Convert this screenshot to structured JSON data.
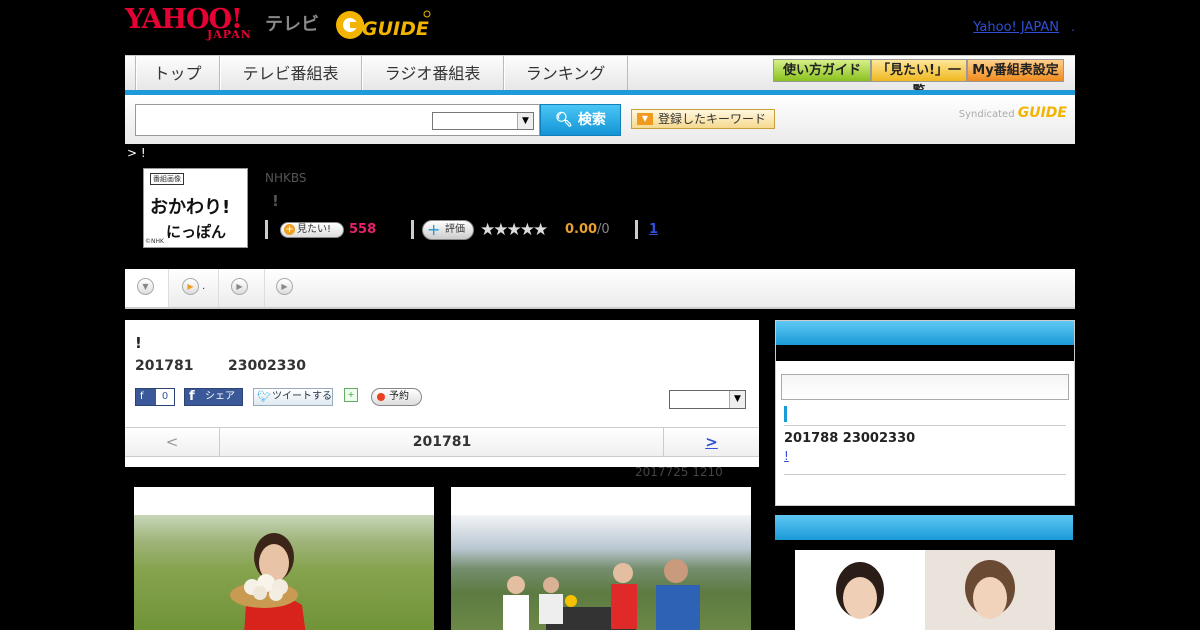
{
  "header": {
    "yahoo_logo": "YAHOO!",
    "yahoo_sub": "JAPAN",
    "tv_label": "テレビ",
    "gguide_logo": "GUIDE",
    "top_link": "Yahoo! JAPAN",
    "top_link_suffix": "."
  },
  "nav": {
    "tabs": [
      "トップ",
      "テレビ番組表",
      "ラジオ番組表",
      "ランキング"
    ],
    "buttons": [
      "使い方ガイド",
      "「見たい!」一覧",
      "My番組表設定"
    ]
  },
  "search": {
    "value": "",
    "select_value": "",
    "button_label": "検索",
    "keyword_button": "登録したキーワード",
    "syndicated": "Syndicated",
    "syndicated_logo": "GUIDE"
  },
  "breadcrumb": ">  !",
  "program": {
    "thumb_badge": "番組画像",
    "thumb_title": "おかわり!",
    "thumb_title2": "にっぽん",
    "thumb_credit": "©NHK",
    "channel": "NHKBS",
    "title": "!",
    "want_label": "見たい!",
    "want_count": "558",
    "rate_label": "評価",
    "stars": "★★★★★",
    "score": "0.00",
    "score_den": "/0",
    "review_count": "1"
  },
  "tabs": {
    "second_label": "."
  },
  "episode": {
    "title": "!",
    "date": "201781",
    "time": "23002330",
    "fb_like": "0",
    "fb_share": "シェア",
    "tweet": "ツイートする",
    "reserve": "予約",
    "select_value": "",
    "prev": "<",
    "current_date": "201781",
    "next": ">",
    "updated": "2017725  1210"
  },
  "sidebar": {
    "input_value": "",
    "next_date": "201788  23002330",
    "next_link": "!"
  }
}
